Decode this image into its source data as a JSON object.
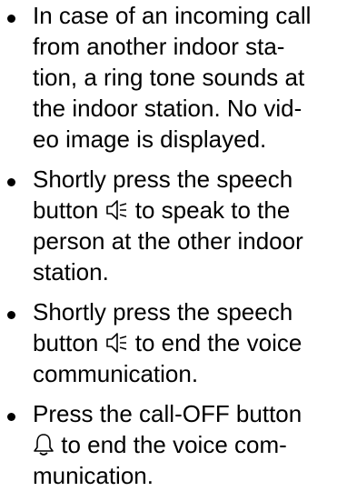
{
  "document": {
    "items": [
      {
        "lines": [
          "In case of an incoming call",
          "from another indoor sta-",
          "tion, a ring tone sounds at",
          "the indoor station. No vid-",
          "eo image is displayed."
        ]
      },
      {
        "line1": "Shortly press the speech",
        "line2_before": "button ",
        "line2_icon": "speaker-icon",
        "line2_after": " to speak to the",
        "line3": "person at the other indoor",
        "line4": "station."
      },
      {
        "line1": "Shortly press the speech",
        "line2_before": "button ",
        "line2_icon": "speaker-icon",
        "line2_after": " to end the voice",
        "line3": "communication."
      },
      {
        "line1": "Press the call-OFF button",
        "line2_icon": "bell-icon",
        "line2_after": " to end the voice com-",
        "line3": "munication."
      }
    ]
  }
}
